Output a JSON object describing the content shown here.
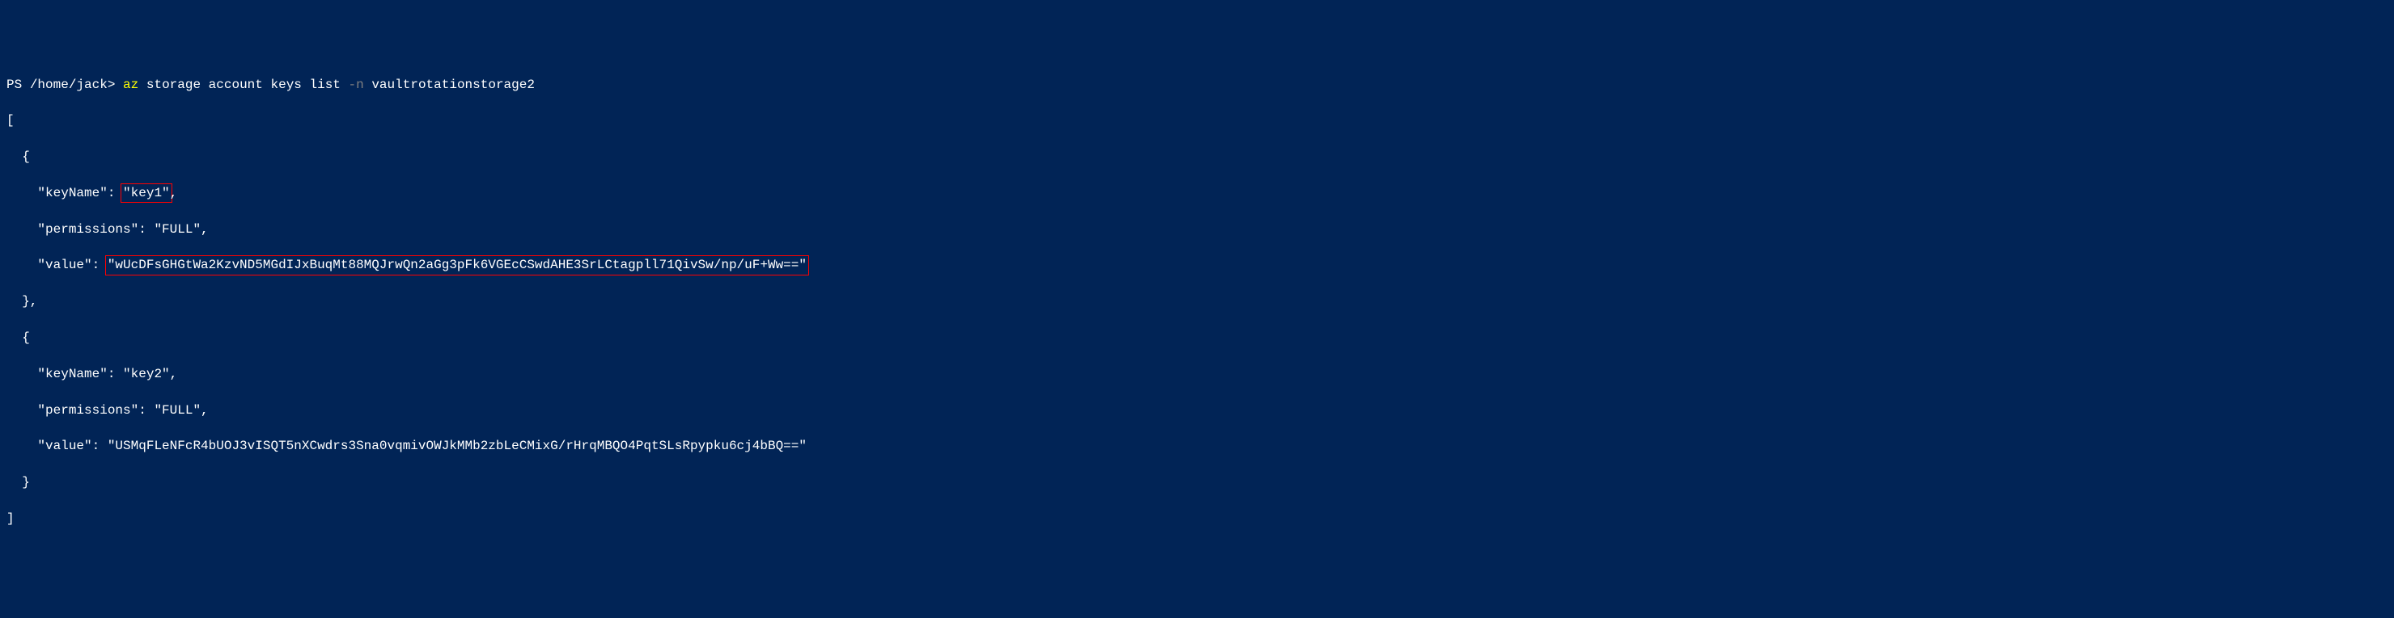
{
  "prompt": {
    "ps": "PS",
    "path": "/home/jack",
    "separator": ">",
    "command_prefix": "az",
    "command_args": "storage account keys list",
    "flag": "-n",
    "flag_value": "vaultrotationstorage2"
  },
  "output": {
    "open_bracket": "[",
    "close_bracket": "]",
    "keys": [
      {
        "keyName_label": "\"keyName\":",
        "keyName_value": "\"key1\"",
        "permissions_label": "\"permissions\":",
        "permissions_value": "\"FULL\"",
        "value_label": "\"value\":",
        "value_value": "\"wUcDFsGHGtWa2KzvND5MGdIJxBuqMt88MQJrwQn2aGg3pFk6VGEcCSwdAHE3SrLCtagpll71QivSw/np/uF+Ww==\"",
        "highlighted": true
      },
      {
        "keyName_label": "\"keyName\":",
        "keyName_value": "\"key2\"",
        "permissions_label": "\"permissions\":",
        "permissions_value": "\"FULL\"",
        "value_label": "\"value\":",
        "value_value": "\"USMqFLeNFcR4bUOJ3vISQT5nXCwdrs3Sna0vqmivOWJkMMb2zbLeCMixG/rHrqMBQO4PqtSLsRpypku6cj4bBQ==\"",
        "highlighted": false
      }
    ]
  }
}
